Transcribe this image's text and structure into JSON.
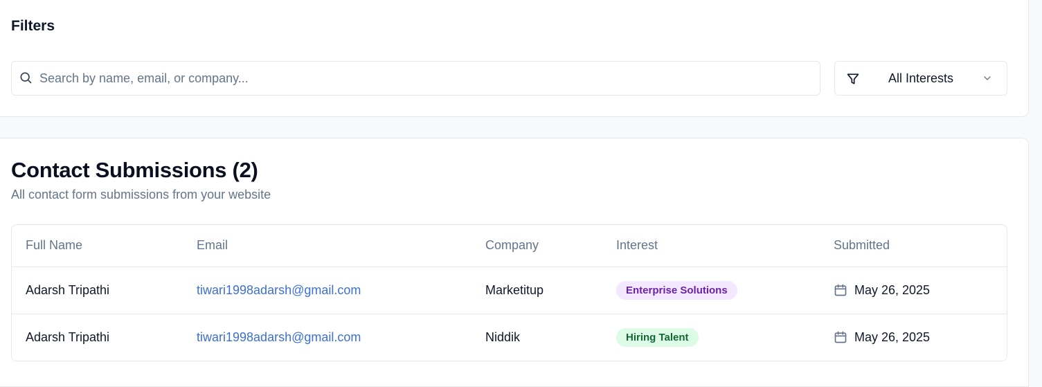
{
  "filters": {
    "title": "Filters",
    "search_placeholder": "Search by name, email, or company...",
    "search_value": "",
    "interest_selected": "All Interests"
  },
  "submissions": {
    "title": "Contact Submissions (2)",
    "description": "All contact form submissions from your website",
    "columns": [
      "Full Name",
      "Email",
      "Company",
      "Interest",
      "Submitted"
    ],
    "rows": [
      {
        "name": "Adarsh Tripathi",
        "email": "tiwari1998adarsh@gmail.com",
        "company": "Marketitup",
        "interest": "Enterprise Solutions",
        "interest_color": "#f3e8ff",
        "submitted": "May 26, 2025"
      },
      {
        "name": "Adarsh Tripathi",
        "email": "tiwari1998adarsh@gmail.com",
        "company": "Niddik",
        "interest": "Hiring Talent",
        "interest_color": "#dcfce7",
        "submitted": "May 26, 2025"
      }
    ]
  },
  "colors": {
    "link": "#3b6fd8",
    "muted_text": "#64748b",
    "border": "#e5e7eb"
  },
  "icons": [
    "search-icon",
    "filter-icon",
    "chevron-down-icon",
    "calendar-icon"
  ]
}
